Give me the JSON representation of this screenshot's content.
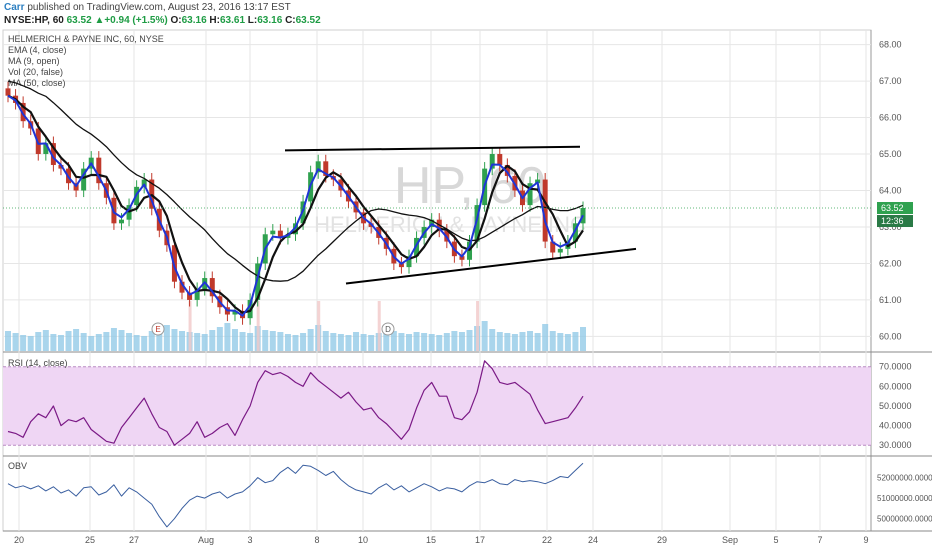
{
  "header": {
    "author": "Carr",
    "published_text": "published on TradingView.com, August 23, 2016 13:17 EST",
    "symbol": "NYSE:HP, 60",
    "last": "63.52",
    "change": "+0.94 (+1.5%)",
    "o_label": "O:",
    "o_value": "63.16",
    "h_label": "H:",
    "h_value": "63.61",
    "l_label": "L:",
    "l_value": "63.16",
    "c_label": "C:",
    "c_value": "63.52"
  },
  "colors": {
    "up": "#2fa14f",
    "down": "#c0392b",
    "ema": "#1f35d6",
    "ma": "#111111",
    "rsi": "#7b1a86",
    "rsi_band": "#efd6f4",
    "obv": "#3a5fa0",
    "volume": "#8cc7e6",
    "grid": "#e6e6e6"
  },
  "chart_data": [
    {
      "type": "candlestick",
      "title": "HELMERICH & PAYNE INC, 60, NYSE",
      "legend": [
        "EMA (4, close)",
        "MA (9, open)",
        "Vol (20, false)",
        "MA (50, close)"
      ],
      "watermark": "HP, 60",
      "watermark_sub": "HELMERICH & PAYNE INC",
      "ylim": [
        59.6,
        68.4
      ],
      "y_ticks": [
        "60.00",
        "61.00",
        "62.00",
        "63.00",
        "64.00",
        "65.00",
        "66.00",
        "67.00",
        "68.00"
      ],
      "x_ticks": [
        "20",
        "25",
        "27",
        "Aug",
        "3",
        "8",
        "10",
        "15",
        "17",
        "22",
        "24",
        "29",
        "Sep",
        "5",
        "7",
        "9"
      ],
      "price_label": "63.52",
      "countdown_label": "12:36",
      "events": [
        "E",
        "D"
      ],
      "closes": [
        66.6,
        66.4,
        65.9,
        65.7,
        65.0,
        65.3,
        64.7,
        64.6,
        64.2,
        64.0,
        64.6,
        64.9,
        64.2,
        63.8,
        63.1,
        63.2,
        63.6,
        64.1,
        64.3,
        63.5,
        62.9,
        62.5,
        61.5,
        61.2,
        61.0,
        61.3,
        61.6,
        61.1,
        60.8,
        60.6,
        60.7,
        60.5,
        61.0,
        62.0,
        62.8,
        62.9,
        62.7,
        62.8,
        63.1,
        63.7,
        64.5,
        64.8,
        64.4,
        64.3,
        64.0,
        63.7,
        63.4,
        63.1,
        63.0,
        62.7,
        62.4,
        62.0,
        61.9,
        62.2,
        62.7,
        63.0,
        63.2,
        62.9,
        62.6,
        62.2,
        62.1,
        62.6,
        63.6,
        64.6,
        65.0,
        64.7,
        64.4,
        64.0,
        63.6,
        64.2,
        64.3,
        62.6,
        62.3,
        62.4,
        62.6,
        63.1,
        63.52
      ],
      "trendlines": {
        "resistance": [
          65.1,
          65.2
        ],
        "support": [
          61.45,
          62.4
        ]
      }
    },
    {
      "type": "line",
      "title": "RSI (14, close)",
      "ylim": [
        25,
        77
      ],
      "y_ticks": [
        "30.0000",
        "40.0000",
        "50.0000",
        "60.0000",
        "70.0000"
      ],
      "band": [
        30,
        70
      ],
      "values": [
        37,
        36,
        34,
        42,
        46,
        44,
        50,
        40,
        43,
        42,
        44,
        38,
        35,
        32,
        31,
        39,
        44,
        49,
        54,
        46,
        39,
        37,
        30,
        33,
        36,
        42,
        34,
        36,
        39,
        41,
        35,
        43,
        50,
        62,
        68,
        66,
        67,
        65,
        62,
        60,
        67,
        63,
        60,
        57,
        54,
        57,
        52,
        48,
        49,
        44,
        41,
        37,
        33,
        38,
        49,
        58,
        62,
        55,
        55,
        44,
        43,
        47,
        57,
        73,
        69,
        62,
        61,
        62,
        59,
        56,
        48,
        41,
        42,
        43,
        44,
        49,
        55
      ]
    },
    {
      "type": "line",
      "title": "OBV",
      "ylim": [
        49400000,
        53000000
      ],
      "y_ticks": [
        "50000000.0000",
        "51000000.0000",
        "52000000.0000"
      ],
      "values": [
        51700000,
        51500000,
        51600000,
        51450000,
        51600000,
        51350000,
        51550000,
        51250000,
        51400000,
        51100000,
        51500000,
        51550000,
        51150000,
        51300000,
        51650000,
        51100000,
        51500000,
        51300000,
        51000000,
        50700000,
        50100000,
        49600000,
        50000000,
        50500000,
        50900000,
        51100000,
        51000000,
        51200000,
        51300000,
        51000000,
        51200000,
        51300000,
        51600000,
        52000000,
        51750000,
        51850000,
        52250000,
        52500000,
        52200000,
        52600000,
        52550000,
        52350000,
        52100000,
        52300000,
        51900000,
        51600000,
        51400000,
        51300000,
        51200000,
        51500000,
        51700000,
        51400000,
        51600000,
        51300000,
        51500000,
        51700000,
        51550000,
        51350000,
        51500000,
        51450000,
        51300000,
        51600000,
        51800000,
        51750000,
        51900000,
        51700000,
        51650000,
        51900000,
        51800000,
        51850000,
        51800000,
        51700000,
        51850000,
        52050000,
        52000000,
        52350000,
        52700000
      ]
    }
  ]
}
